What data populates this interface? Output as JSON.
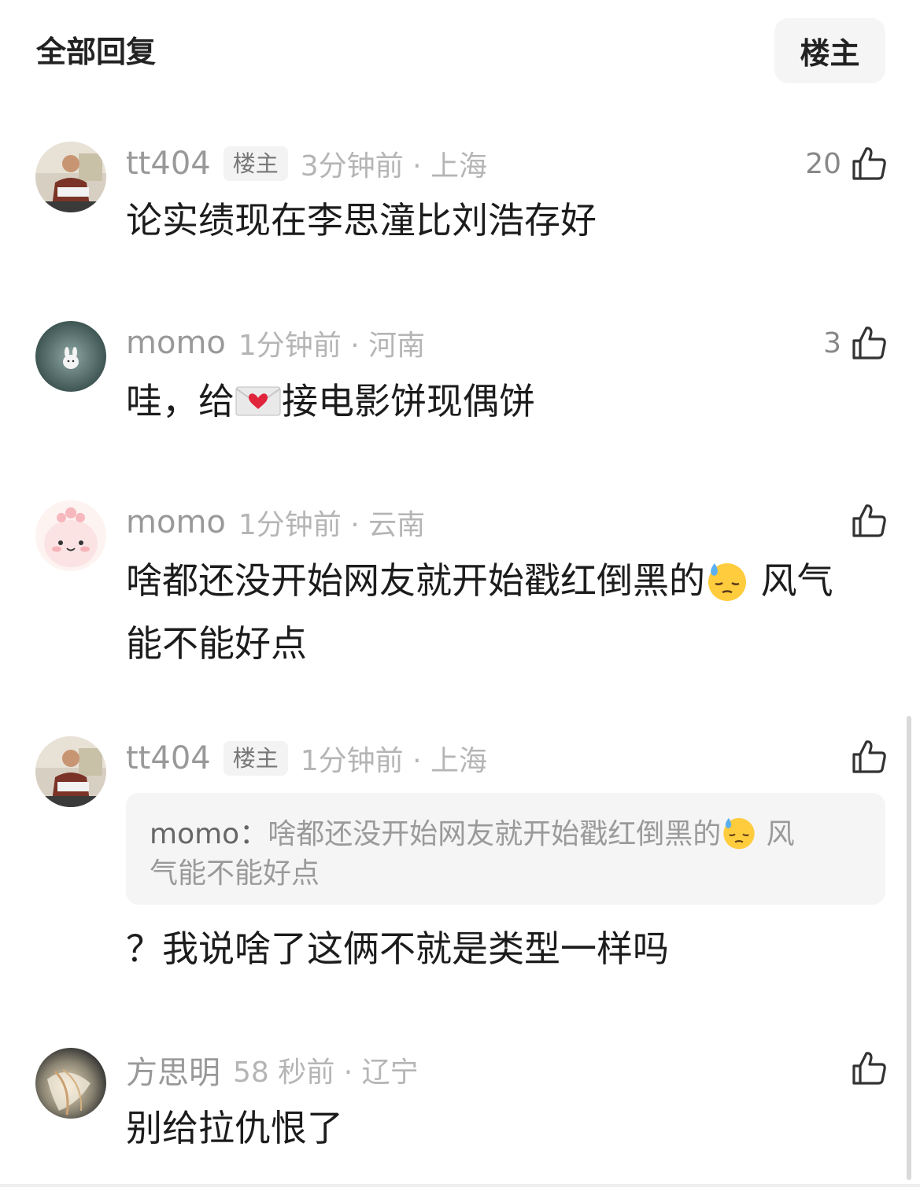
{
  "header": {
    "title": "全部回复",
    "owner_filter": "楼主"
  },
  "comments": [
    {
      "user": "tt404",
      "is_owner": true,
      "owner_tag": "楼主",
      "time_loc": "3分钟前 · 上海",
      "likes": "20",
      "text": "论实绩现在李思潼比刘浩存好"
    },
    {
      "user": "momo",
      "is_owner": false,
      "time_loc": "1分钟前 · 河南",
      "likes": "3",
      "text_before": "哇，给",
      "emoji": "love-letter-emoji",
      "text_after": "接电影饼现偶饼"
    },
    {
      "user": "momo",
      "is_owner": false,
      "time_loc": "1分钟前 · 云南",
      "likes": "",
      "text_line1_before": "啥都还没开始网友就开始戳红倒黑的",
      "emoji": "downcast-sweat-emoji",
      "text_line1_after": " 风气",
      "text_line2": "能不能好点"
    },
    {
      "user": "tt404",
      "is_owner": true,
      "owner_tag": "楼主",
      "time_loc": "1分钟前 · 上海",
      "likes": "",
      "quote_user": "momo：",
      "quote_line1_before": "啥都还没开始网友就开始戳红倒黑的",
      "quote_emoji": "downcast-sweat-emoji",
      "quote_line1_after": " 风",
      "quote_line2": "气能不能好点",
      "text": "？我说啥了这俩不就是类型一样吗"
    },
    {
      "user": "方思明",
      "is_owner": false,
      "time_loc": "58 秒前 · 辽宁",
      "likes": "",
      "text": "别给拉仇恨了"
    }
  ],
  "colors": {
    "accent_text": "#1c1c1c",
    "meta_text": "#999999",
    "tag_bg": "#f3f3f3",
    "quote_bg": "#f5f5f5"
  },
  "icons": [
    "thumbs-up-icon",
    "love-letter-emoji",
    "downcast-sweat-emoji"
  ]
}
